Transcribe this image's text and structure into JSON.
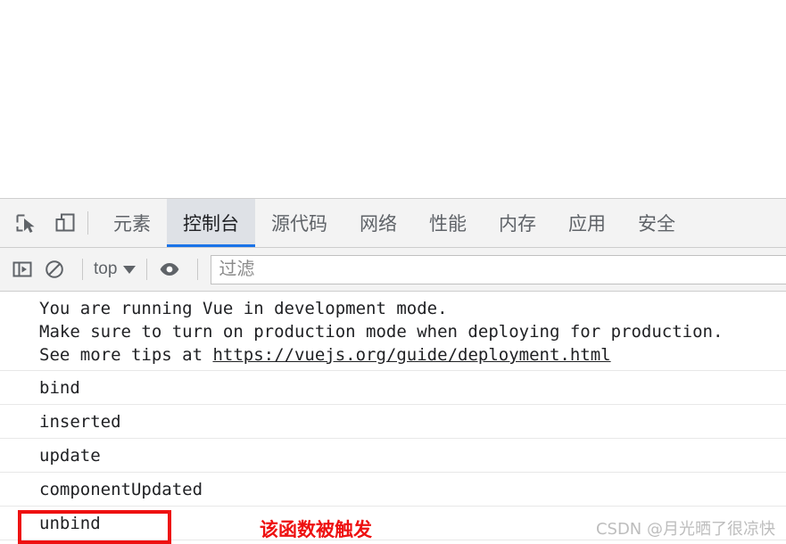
{
  "devtools": {
    "toolbar_icons": [
      {
        "name": "inspect-element-icon",
        "title": "inspect"
      },
      {
        "name": "device-toolbar-icon",
        "title": "device"
      }
    ],
    "tabs": [
      {
        "label": "元素",
        "active": false
      },
      {
        "label": "控制台",
        "active": true
      },
      {
        "label": "源代码",
        "active": false
      },
      {
        "label": "网络",
        "active": false
      },
      {
        "label": "性能",
        "active": false
      },
      {
        "label": "内存",
        "active": false
      },
      {
        "label": "应用",
        "active": false
      },
      {
        "label": "安全",
        "active": false
      }
    ],
    "filter_bar": {
      "sidebar_toggle_icon": "console-sidebar-icon",
      "clear_console_icon": "clear-console-icon",
      "context_label": "top",
      "eye_icon": "live-expression-eye-icon",
      "filter_placeholder": "过滤",
      "filter_value": ""
    }
  },
  "console": {
    "vue_warning": {
      "line1": "You are running Vue in development mode.",
      "line2": "Make sure to turn on production mode when deploying for production.",
      "line3_prefix": "See more tips at ",
      "link": "https://vuejs.org/guide/deployment.html"
    },
    "logs": [
      {
        "text": "bind"
      },
      {
        "text": "inserted"
      },
      {
        "text": "update"
      },
      {
        "text": "componentUpdated"
      },
      {
        "text": "unbind",
        "highlighted": true
      }
    ]
  },
  "annotations": {
    "red_note": "该函数被触发",
    "red_color": "#ee1111",
    "watermark": "CSDN @月光晒了很凉快"
  }
}
